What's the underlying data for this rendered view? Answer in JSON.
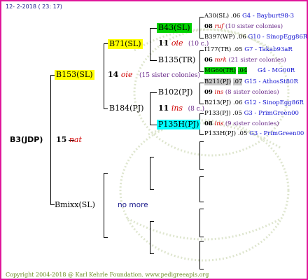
{
  "header": {
    "date_text": "12-  2-2018 ( 23: 17)"
  },
  "footer": {
    "copyright": "Copyright 2004-2018 @ Karl Kehrle Foundation.   www.pedigreeapis.org"
  },
  "root": {
    "label": "B3(JDP)",
    "num": "15",
    "race": "nat"
  },
  "gen1": {
    "top": {
      "label": "B153(SL)",
      "num": "14",
      "race": "oie",
      "note": "(15 sister colonies)"
    },
    "bottom": {
      "label": "Bmixx(SL)",
      "note": "no more"
    }
  },
  "gen2": {
    "a": {
      "label": "B71(SL)"
    },
    "b": {
      "label": "B184(PJ)"
    }
  },
  "gen3": {
    "a": {
      "label": "B43(SL)",
      "num": "11",
      "race": "oie",
      "note": "(10 c.)"
    },
    "b": {
      "label": "B135(TR)"
    },
    "c": {
      "label": "B102(PJ)"
    },
    "d": {
      "label": "P135H(PJ)",
      "num": "11",
      "race": "ins",
      "note": "(8 c.)"
    }
  },
  "gen4": [
    {
      "label": "A30(SL)",
      "val": ".06",
      "ref": "G4 - Bayburt98-3"
    },
    {
      "label": "08",
      "race": "ruf",
      "note": "(10 sister colonies)"
    },
    {
      "label": "B397(WP)",
      "val": ".06",
      "ref": "G10 - SinopEgg86R"
    },
    {
      "label": "I177(TR)",
      "val": ".05",
      "ref": "G7 - Takab93aR"
    },
    {
      "label": "06",
      "race": "mrk",
      "note": "(21 sister colonies)"
    },
    {
      "label": "MG60(TR)",
      "val": ".04",
      "ref": "G4 - MG00R"
    },
    {
      "label": "B211(PJ)",
      "val": ".07",
      "ref": "G15 - AthosSt80R"
    },
    {
      "label": "09",
      "race": "ins",
      "note": "(8 sister colonies)"
    },
    {
      "label": "B213(PJ)",
      "val": ".06",
      "ref": "G12 - SinopEgg86R"
    },
    {
      "label": "P133(PJ)",
      "val": ".05",
      "ref": "G3 - PrimGreen00"
    },
    {
      "label": "08",
      "race": "ins",
      "note": "(9 sister colonies)"
    },
    {
      "label": "P133H(PJ)",
      "val": ".05",
      "ref": "G3 - PrimGreen00"
    }
  ],
  "colors": {
    "border": "#e0169a",
    "yellow": "#ffff00",
    "green": "#00d000",
    "cyan": "#00ffff",
    "grey": "#c8c8c8"
  }
}
